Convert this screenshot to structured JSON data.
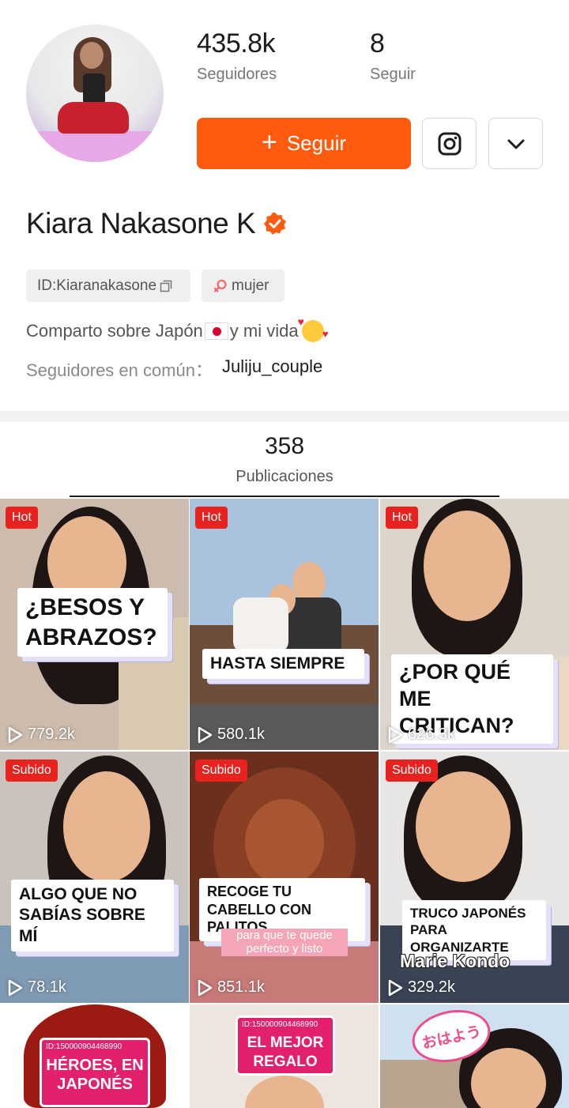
{
  "profile": {
    "followers_count": "435.8k",
    "followers_label": "Seguidores",
    "following_count": "8",
    "following_label": "Seguir",
    "follow_button_label": "Seguir",
    "name": "Kiara Nakasone K",
    "id_chip": "ID:Kiaranakasone",
    "gender_chip": "mujer",
    "bio_text_1": "Comparto sobre Japón",
    "bio_text_2": " y mi vida",
    "mutual_label": "Seguidores en común：",
    "mutual_user": "Juliju_couple"
  },
  "posts": {
    "count": "358",
    "label": "Publicaciones",
    "items": [
      {
        "badge": "Hot",
        "caption": "¿BESOS Y ABRAZOS?",
        "views": "779.2k",
        "bg": "#c9b6a6"
      },
      {
        "badge": "Hot",
        "caption": "HASTA SIEMPRE",
        "views": "580.1k",
        "bg": "#a9c3df"
      },
      {
        "badge": "Hot",
        "caption": "¿POR QUÉ ME CRITICAN?",
        "views": "626.3k",
        "bg": "#ddd4cc"
      },
      {
        "badge": "Subido",
        "caption": "ALGO QUE NO SABÍAS SOBRE MÍ",
        "views": "78.1k",
        "bg": "#c9c2bd"
      },
      {
        "badge": "Subido",
        "caption": "RECOGE TU CABELLO CON PALITOS",
        "subcaption": "para que te quede perfecto y listo",
        "views": "851.1k",
        "bg": "#6b2f1e"
      },
      {
        "badge": "Subido",
        "caption": "TRUCO JAPONÉS PARA ORGANIZARTE",
        "subcaption": "Marie Kondo",
        "views": "329.2k",
        "bg": "#e8e6e4"
      },
      {
        "badge": "",
        "card_id": "ID:150000904468990",
        "caption": "HÉROES, EN JAPONÉS",
        "views": "",
        "bg": "#ffffff"
      },
      {
        "badge": "",
        "card_id": "ID:150000904468990",
        "caption": "EL MEJOR REGALO",
        "views": "",
        "bg": "#ede5df"
      },
      {
        "badge": "",
        "caption": "おはよう",
        "views": "",
        "bg": "#cfe0f0"
      }
    ]
  },
  "icons": {
    "instagram": "instagram-icon",
    "dropdown": "chevron-down-icon",
    "verified": "verified-badge-icon",
    "copy": "copy-icon",
    "gender": "female-symbol-icon",
    "play": "play-icon"
  },
  "colors": {
    "accent": "#ff5a0e",
    "badge_red": "#e8231f",
    "pink_card": "#e3206e"
  }
}
